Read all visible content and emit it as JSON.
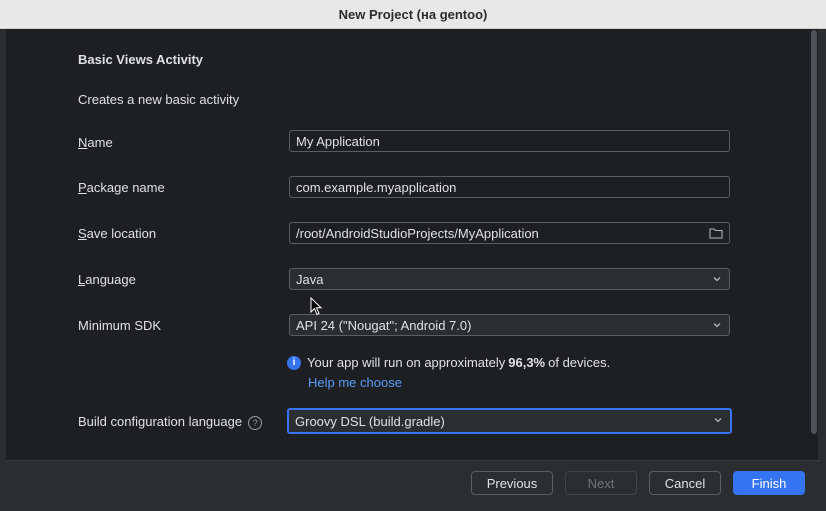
{
  "window": {
    "title": "New Project (на gentoo)"
  },
  "form": {
    "heading": "Basic Views Activity",
    "description": "Creates a new basic activity",
    "name": {
      "label_mnemonic": "N",
      "label_rest": "ame",
      "value": "My Application"
    },
    "package": {
      "label_mnemonic": "P",
      "label_rest": "ackage name",
      "value": "com.example.myapplication"
    },
    "save_location": {
      "label_mnemonic": "S",
      "label_rest": "ave location",
      "value": "/root/AndroidStudioProjects/MyApplication"
    },
    "language": {
      "label_mnemonic": "L",
      "label_rest": "anguage",
      "value": "Java"
    },
    "min_sdk": {
      "label": "Minimum SDK",
      "value": "API 24 (\"Nougat\"; Android 7.0)"
    },
    "info": {
      "prefix": "Your app will run on approximately",
      "percent": "96,3%",
      "suffix": "of devices.",
      "help_link": "Help me choose"
    },
    "build_lang": {
      "label": "Build configuration language",
      "value": "Groovy DSL (build.gradle)"
    }
  },
  "footer": {
    "previous": "Previous",
    "next": "Next",
    "cancel": "Cancel",
    "finish": "Finish"
  },
  "colors": {
    "accent": "#3574f0",
    "link": "#589df6"
  }
}
